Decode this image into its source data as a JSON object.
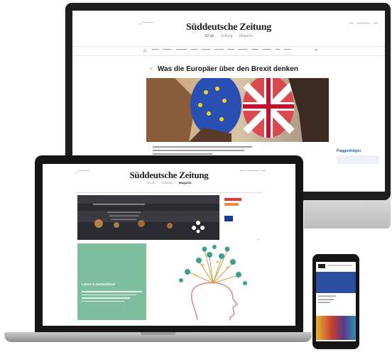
{
  "desktop": {
    "logo": "Süddeutsche Zeitung",
    "subnav": [
      "SZ.de",
      "Zeitung",
      "Magazin"
    ],
    "headline": "Was die Europäer über den Brexit denken",
    "sidebar_title": "Flaggenfolgen"
  },
  "laptop": {
    "logo": "Süddeutsche Zeitung",
    "subnav": [
      "SZ.de",
      "Zeitung",
      "Magazin"
    ],
    "card_title": "Leben in Deutschland"
  }
}
